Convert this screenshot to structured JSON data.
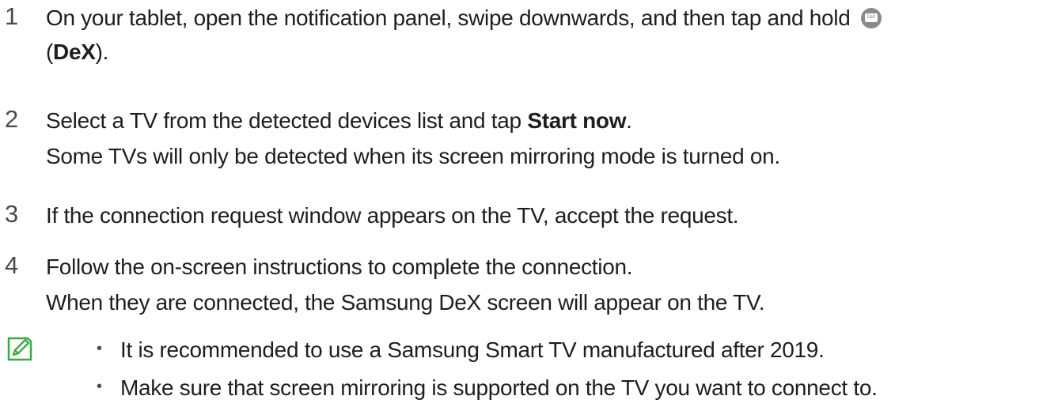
{
  "steps": [
    {
      "number": "1",
      "line1_text": "On your tablet, open the notification panel, swipe downwards, and then tap and hold",
      "icon_name": "dex-icon",
      "icon_caption": "DeX",
      "line2_open": "(",
      "line2_bold": "DeX",
      "line2_close": ")."
    },
    {
      "number": "2",
      "line1_text": "Select a TV from the detected devices list and tap ",
      "line1_bold": "Start now",
      "line1_end": ".",
      "line2_text": "Some TVs will only be detected when its screen mirroring mode is turned on."
    },
    {
      "number": "3",
      "line1_text": "If the connection request window appears on the TV, accept the request."
    },
    {
      "number": "4",
      "line1_text": "Follow the on-screen instructions to complete the connection.",
      "line2_text": "When they are connected, the Samsung DeX screen will appear on the TV."
    }
  ],
  "note": {
    "icon_name": "note-pencil-icon",
    "bullet_symbol": "•",
    "bullets": [
      "It is recommended to use a Samsung Smart TV manufactured after 2019.",
      "Make sure that screen mirroring is supported on the TV you want to connect to."
    ]
  },
  "colors": {
    "text": "#1e1e1e",
    "step_number": "#4a4a4a",
    "icon_gray": "#8a8a8a",
    "note_icon_green": "#3aa845"
  }
}
